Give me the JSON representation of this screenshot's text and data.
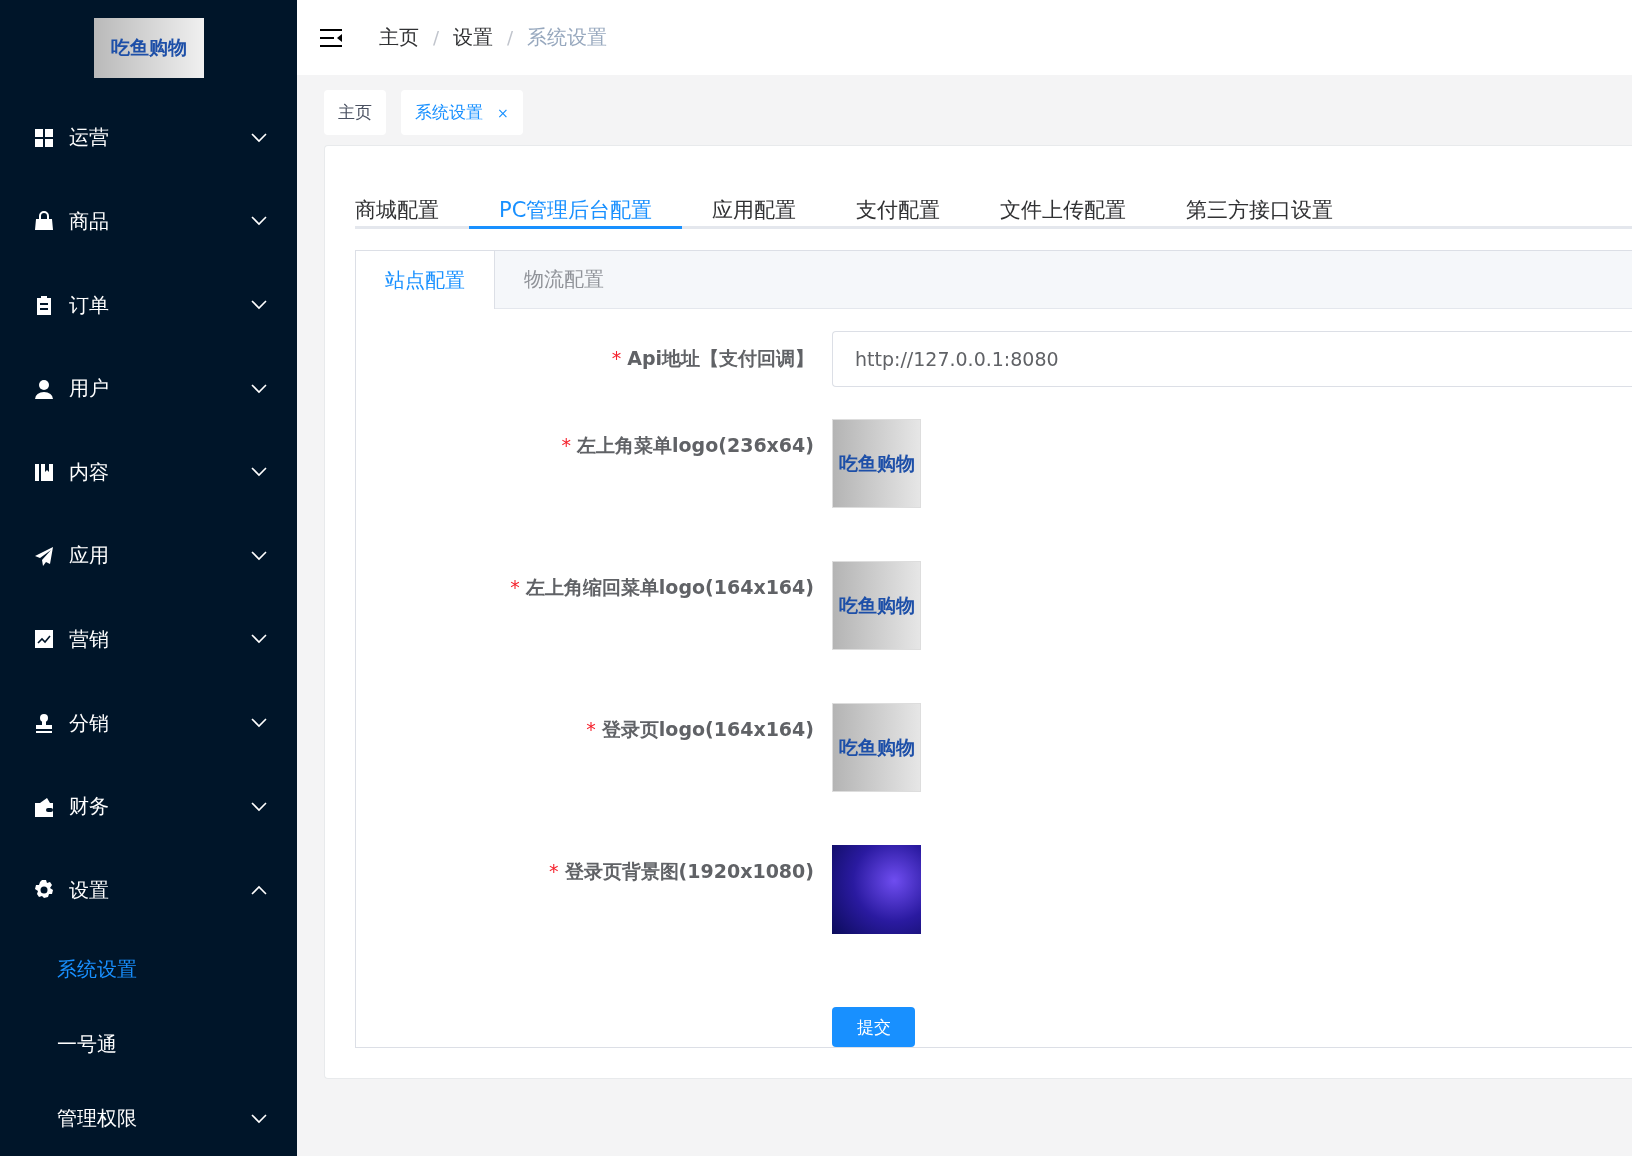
{
  "sidebar": {
    "logo_text": "吃鱼购物",
    "items": [
      {
        "label": "运营",
        "expanded": false
      },
      {
        "label": "商品",
        "expanded": false
      },
      {
        "label": "订单",
        "expanded": false
      },
      {
        "label": "用户",
        "expanded": false
      },
      {
        "label": "内容",
        "expanded": false
      },
      {
        "label": "应用",
        "expanded": false
      },
      {
        "label": "营销",
        "expanded": false
      },
      {
        "label": "分销",
        "expanded": false
      },
      {
        "label": "财务",
        "expanded": false
      },
      {
        "label": "设置",
        "expanded": true,
        "children": [
          {
            "label": "系统设置",
            "selected": true,
            "kind": "link"
          },
          {
            "label": "一号通",
            "selected": false,
            "kind": "link"
          },
          {
            "label": "管理权限",
            "selected": false,
            "kind": "group"
          }
        ]
      }
    ]
  },
  "breadcrumb": [
    {
      "label": "主页",
      "current": false
    },
    {
      "separator": "/",
      "label": "设置",
      "current": false
    },
    {
      "separator": "/",
      "label": "系统设置",
      "current": true
    }
  ],
  "page_tabs": [
    {
      "label": "主页",
      "selected": false
    },
    {
      "label": "系统设置",
      "selected": true,
      "close": "×"
    }
  ],
  "config_tabs": [
    {
      "label": "商城配置",
      "selected": false
    },
    {
      "label": "PC管理后台配置",
      "selected": true
    },
    {
      "label": "应用配置",
      "selected": false
    },
    {
      "label": "支付配置",
      "selected": false
    },
    {
      "label": "文件上传配置",
      "selected": false
    },
    {
      "label": "第三方接口设置",
      "selected": false
    }
  ],
  "sub_tabs": [
    {
      "label": "站点配置",
      "selected": true
    },
    {
      "label": "物流配置",
      "selected": false
    }
  ],
  "form": {
    "fields": [
      {
        "kind": "text",
        "required_mark": "*",
        "label": "Api地址【支付回调】",
        "value": "http://127.0.0.1:8080"
      },
      {
        "kind": "image",
        "required_mark": "*",
        "label": "左上角菜单logo(236x64)",
        "image_text": "吃鱼购物"
      },
      {
        "kind": "image",
        "required_mark": "*",
        "label": "左上角缩回菜单logo(164x164)",
        "image_text": "吃鱼购物"
      },
      {
        "kind": "image",
        "required_mark": "*",
        "label": "登录页logo(164x164)",
        "image_text": "吃鱼购物"
      },
      {
        "kind": "photo",
        "required_mark": "*",
        "label": "登录页背景图(1920x1080)"
      }
    ],
    "submit": "提交"
  }
}
